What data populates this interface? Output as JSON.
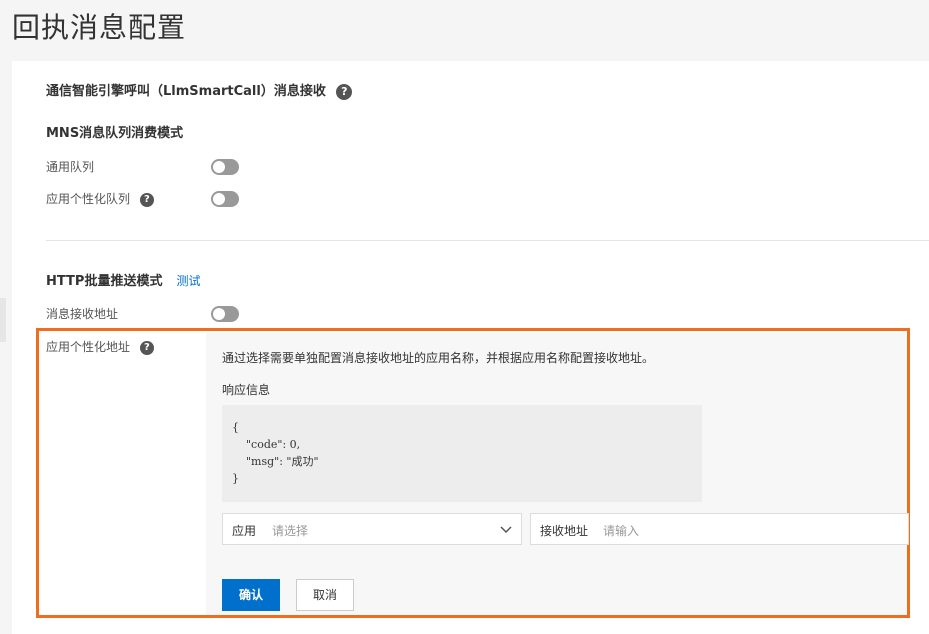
{
  "page": {
    "title": "回执消息配置"
  },
  "section_main": {
    "title": "通信智能引擎呼叫（LlmSmartCall）消息接收"
  },
  "mns": {
    "title": "MNS消息队列消费模式",
    "general_queue_label": "通用队列",
    "general_queue_enabled": false,
    "app_queue_label": "应用个性化队列",
    "app_queue_enabled": false
  },
  "http": {
    "title": "HTTP批量推送模式",
    "test_link": "测试",
    "receive_address_label": "消息接收地址",
    "receive_address_enabled": false,
    "app_address_label": "应用个性化地址",
    "description": "通过选择需要单独配置消息接收地址的应用名称，并根据应用名称配置接收地址。",
    "response_label": "响应信息",
    "response_code": "{\n    \"code\": 0,\n    \"msg\": \"成功\"\n}",
    "app_select": {
      "label": "应用",
      "placeholder": "请选择"
    },
    "address_input": {
      "label": "接收地址",
      "placeholder": "请输入"
    },
    "confirm_button": "确认",
    "cancel_button": "取消"
  },
  "colors": {
    "primary": "#0070cc",
    "highlight": "#ef6d1d",
    "toggle_off": "#999999"
  },
  "icons": [
    "help-icon",
    "chevron-down-icon"
  ]
}
